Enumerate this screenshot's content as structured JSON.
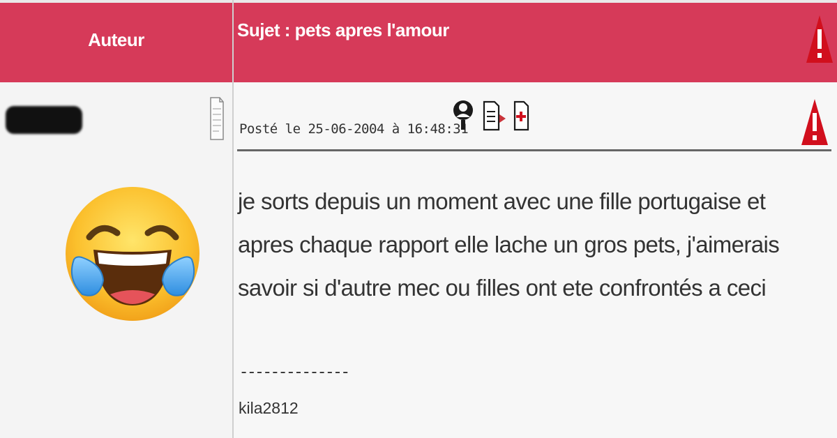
{
  "header": {
    "author_label": "Auteur",
    "subject_label": "Sujet : pets apres l'amour"
  },
  "author": {
    "avatar_icon": "tears-of-joy-emoji-icon",
    "profile_icon": "document-icon"
  },
  "post": {
    "meta": "Posté le 25-06-2004 à 16:48:31",
    "action_icons": [
      "profile-icon",
      "quote-icon",
      "add-favorite-icon"
    ],
    "warning_icon": "alert-triangle-icon",
    "body": "je sorts depuis un moment avec une fille portugaise et apres chaque rapport elle lache un gros pets, j'aimerais savoir si d'autre mec ou filles ont ete confrontés a ceci",
    "signature_rule": "--------------",
    "signature": "kila2812"
  },
  "colors": {
    "header_bg": "#d63a59",
    "warning_red": "#d10f1d",
    "text": "#333333"
  }
}
